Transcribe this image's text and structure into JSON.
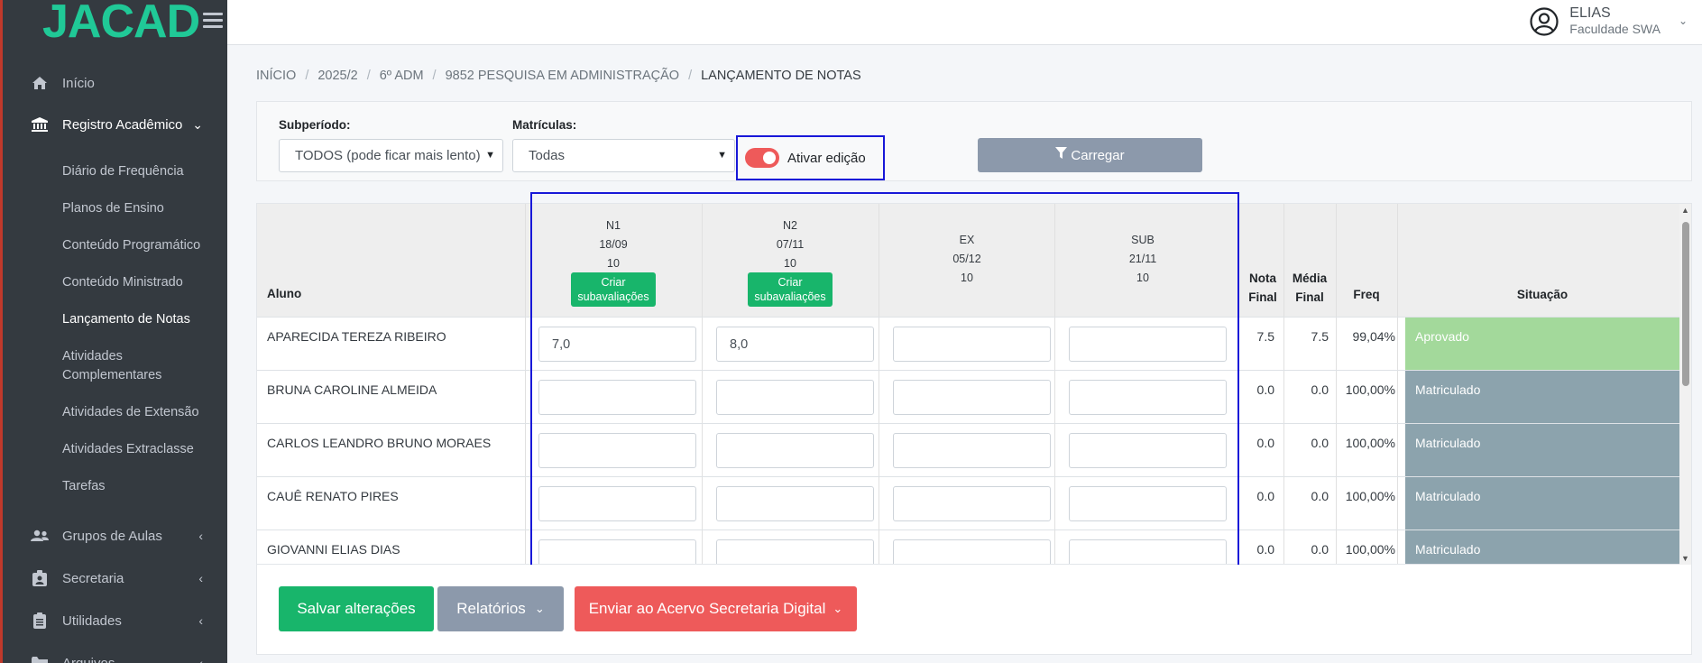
{
  "app": {
    "logo": "JACAD"
  },
  "sidebar": {
    "items": [
      {
        "label": "Início",
        "icon": "home-icon"
      },
      {
        "label": "Registro Acadêmico",
        "icon": "institution-icon"
      },
      {
        "label": "Grupos de Aulas",
        "icon": "users-icon"
      },
      {
        "label": "Secretaria",
        "icon": "id-badge-icon"
      },
      {
        "label": "Utilidades",
        "icon": "clipboard-icon"
      },
      {
        "label": "Arquivos",
        "icon": "folder-icon"
      }
    ],
    "subitems": [
      {
        "label": "Diário de Frequência"
      },
      {
        "label": "Planos de Ensino"
      },
      {
        "label": "Conteúdo Programático"
      },
      {
        "label": "Conteúdo Ministrado"
      },
      {
        "label": "Lançamento de Notas"
      },
      {
        "label": "Atividades Complementares"
      },
      {
        "label": "Atividades de Extensão"
      },
      {
        "label": "Atividades Extraclasse"
      },
      {
        "label": "Tarefas"
      }
    ]
  },
  "user": {
    "name": "ELIAS",
    "org": "Faculdade SWA"
  },
  "breadcrumb": [
    "INÍCIO",
    "2025/2",
    "6º ADM",
    "9852 PESQUISA EM ADMINISTRAÇÃO",
    "LANÇAMENTO DE NOTAS"
  ],
  "filters": {
    "subperiodo_label": "Subperíodo:",
    "subperiodo_value": "TODOS (pode ficar mais lento)",
    "matriculas_label": "Matrículas:",
    "matriculas_value": "Todas",
    "toggle_label": "Ativar edição",
    "carregar_label": "Carregar"
  },
  "table": {
    "headers": {
      "aluno": "Aluno",
      "nota_final": "Nota Final",
      "media_final": "Média Final",
      "freq": "Freq",
      "situacao": "Situação"
    },
    "grade_columns": [
      {
        "name": "N1",
        "date": "18/09",
        "weight": "10",
        "button": "Criar subavaliações"
      },
      {
        "name": "N2",
        "date": "07/11",
        "weight": "10",
        "button": "Criar subavaliações"
      },
      {
        "name": "EX",
        "date": "05/12",
        "weight": "10",
        "button": ""
      },
      {
        "name": "SUB",
        "date": "21/11",
        "weight": "10",
        "button": ""
      }
    ],
    "rows": [
      {
        "aluno": "APARECIDA TEREZA RIBEIRO",
        "grades": [
          "7,0",
          "8,0",
          "",
          ""
        ],
        "nota_final": "7.5",
        "media_final": "7.5",
        "freq": "99,04%",
        "situacao": "Aprovado",
        "situacao_color": "#a3d99b"
      },
      {
        "aluno": "BRUNA CAROLINE ALMEIDA",
        "grades": [
          "",
          "",
          "",
          ""
        ],
        "nota_final": "0.0",
        "media_final": "0.0",
        "freq": "100,00%",
        "situacao": "Matriculado",
        "situacao_color": "#8ca3ad"
      },
      {
        "aluno": "CARLOS LEANDRO BRUNO MORAES",
        "grades": [
          "",
          "",
          "",
          ""
        ],
        "nota_final": "0.0",
        "media_final": "0.0",
        "freq": "100,00%",
        "situacao": "Matriculado",
        "situacao_color": "#8ca3ad"
      },
      {
        "aluno": "CAUÊ RENATO PIRES",
        "grades": [
          "",
          "",
          "",
          ""
        ],
        "nota_final": "0.0",
        "media_final": "0.0",
        "freq": "100,00%",
        "situacao": "Matriculado",
        "situacao_color": "#8ca3ad"
      },
      {
        "aluno": "GIOVANNI ELIAS DIAS",
        "grades": [
          "",
          "",
          "",
          ""
        ],
        "nota_final": "0.0",
        "media_final": "0.0",
        "freq": "100,00%",
        "situacao": "Matriculado",
        "situacao_color": "#8ca3ad"
      }
    ]
  },
  "actions": {
    "salvar": "Salvar alterações",
    "relatorios": "Relatórios",
    "enviar": "Enviar ao Acervo Secretaria Digital"
  },
  "colors": {
    "accent": "#20c997",
    "sidebar": "#343a40",
    "save": "#18b56b",
    "report": "#8c99ab",
    "send": "#ee5a5a",
    "highlight": "#1818d8"
  }
}
